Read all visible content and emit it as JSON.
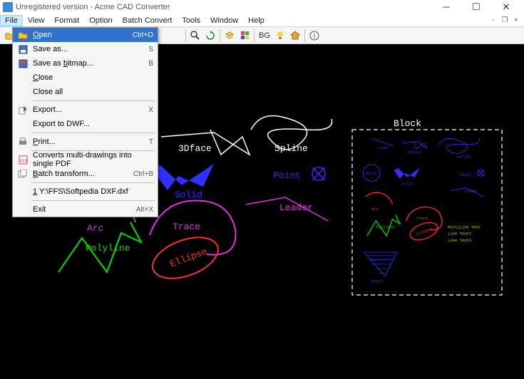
{
  "titlebar": {
    "text": "Unregistered version - Acme CAD Converter"
  },
  "menubar": {
    "file": "File",
    "view": "View",
    "format": "Format",
    "option": "Option",
    "batch": "Batch Convert",
    "tools": "Tools",
    "window": "Window",
    "help": "Help"
  },
  "toolbar": {
    "bg_label": "BG"
  },
  "file_menu": {
    "open": {
      "label": "Open",
      "shortcut": "Ctrl+O"
    },
    "save_as": {
      "label": "Save as...",
      "shortcut": "S"
    },
    "save_bitmap": {
      "label": "Save as bitmap...",
      "shortcut": "B"
    },
    "close": {
      "label": "Close"
    },
    "close_all": {
      "label": "Close all"
    },
    "export": {
      "label": "Export...",
      "shortcut": "X"
    },
    "export_dwf": {
      "label": "Export to DWF..."
    },
    "print": {
      "label": "Print...",
      "shortcut": "T"
    },
    "convert_pdf": {
      "label": "Converts multi-drawings into single PDF"
    },
    "batch_transform": {
      "label": "Batch transform...",
      "shortcut": "Ctrl+B"
    },
    "recent1": {
      "label": "1 Y:\\FFS\\Softpedia DXF.dxf"
    },
    "exit": {
      "label": "Exit",
      "shortcut": "Alt+X"
    }
  },
  "cad_labels": {
    "block": "Block",
    "threedface": "3Dface",
    "spline": "Spline",
    "point": "Point",
    "leader": "Leader",
    "solid": "Solid",
    "arc": "Arc",
    "polyline": "Polyline",
    "trace": "Trace",
    "ellipse": "Ellipse",
    "mini_line": "Line",
    "mini_3dface": "3Dface",
    "mini_spline": "Spline",
    "mini_block": "Block",
    "mini_solid": "Solid",
    "mini_point": "Point",
    "mini_leader": "Leader",
    "mini_arc": "Arc",
    "mini_polyline": "Polyline",
    "mini_trace": "Trace",
    "mini_ellipse": "Ellipse",
    "mini_mtext1": "MultiLine Text",
    "mini_mtext2": "Line Text2",
    "mini_mtext3": "Line Text3",
    "mini_hatch": "Hatch"
  }
}
